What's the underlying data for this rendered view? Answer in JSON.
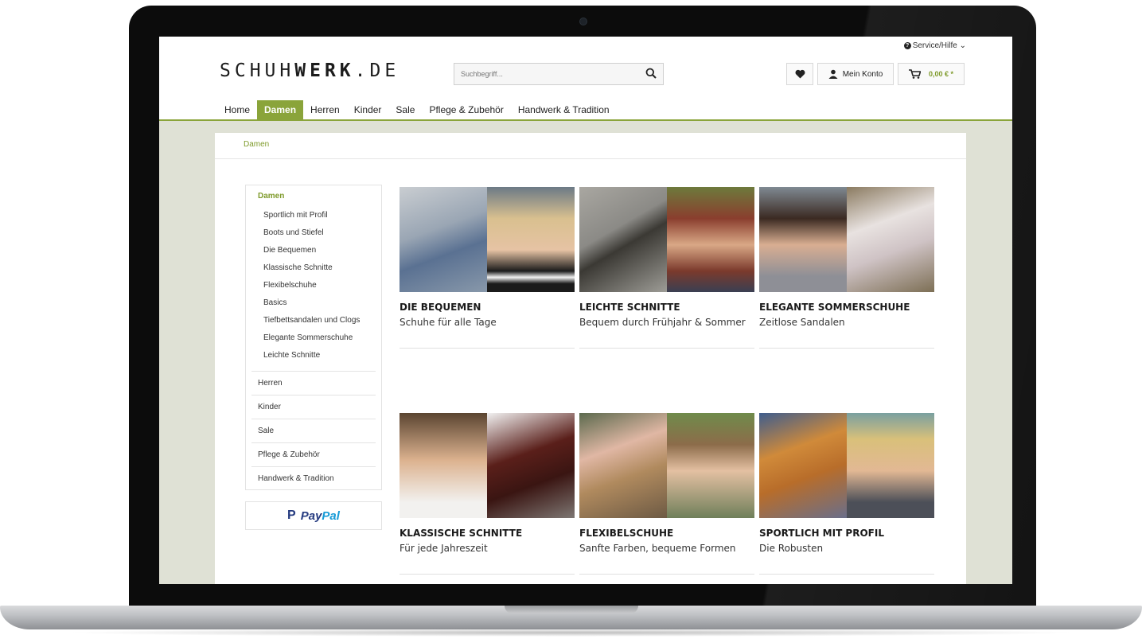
{
  "header": {
    "service_label": "Service/Hilfe",
    "logo_light": "SCHUH",
    "logo_bold": "WERK",
    "logo_suffix": ".DE",
    "search_placeholder": "Suchbegriff...",
    "account_label": "Mein Konto",
    "cart_amount": "0,00 € *"
  },
  "nav": {
    "items": [
      "Home",
      "Damen",
      "Herren",
      "Kinder",
      "Sale",
      "Pflege & Zubehör",
      "Handwerk & Tradition"
    ],
    "active": "Damen"
  },
  "breadcrumb": "Damen",
  "sidebar": {
    "heading": "Damen",
    "subitems": [
      "Sportlich mit Profil",
      "Boots und Stiefel",
      "Die Bequemen",
      "Klassische Schnitte",
      "Flexibelschuhe",
      "Basics",
      "Tiefbettsandalen und Clogs",
      "Elegante Sommerschuhe",
      "Leichte Schnitte"
    ],
    "main_items": [
      "Herren",
      "Kinder",
      "Sale",
      "Pflege & Zubehör",
      "Handwerk & Tradition"
    ]
  },
  "paypal": {
    "part1": "Pay",
    "part2": "Pal",
    "mark": "P"
  },
  "tiles": [
    {
      "title": "DIE BEQUEMEN",
      "subtitle": "Schuhe für alle Tage"
    },
    {
      "title": "LEICHTE SCHNITTE",
      "subtitle": "Bequem durch Frühjahr & Sommer"
    },
    {
      "title": "ELEGANTE SOMMERSCHUHE",
      "subtitle": "Zeitlose Sandalen"
    },
    {
      "title": "KLASSISCHE SCHNITTE",
      "subtitle": "Für jede Jahreszeit"
    },
    {
      "title": "FLEXIBELSCHUHE",
      "subtitle": "Sanfte Farben, bequeme Formen"
    },
    {
      "title": "SPORTLICH MIT PROFIL",
      "subtitle": "Die Robusten"
    }
  ],
  "colors": {
    "accent": "#8aa43a",
    "accent_text": "#7e9a2a",
    "page_bg": "#dfe1d5"
  }
}
